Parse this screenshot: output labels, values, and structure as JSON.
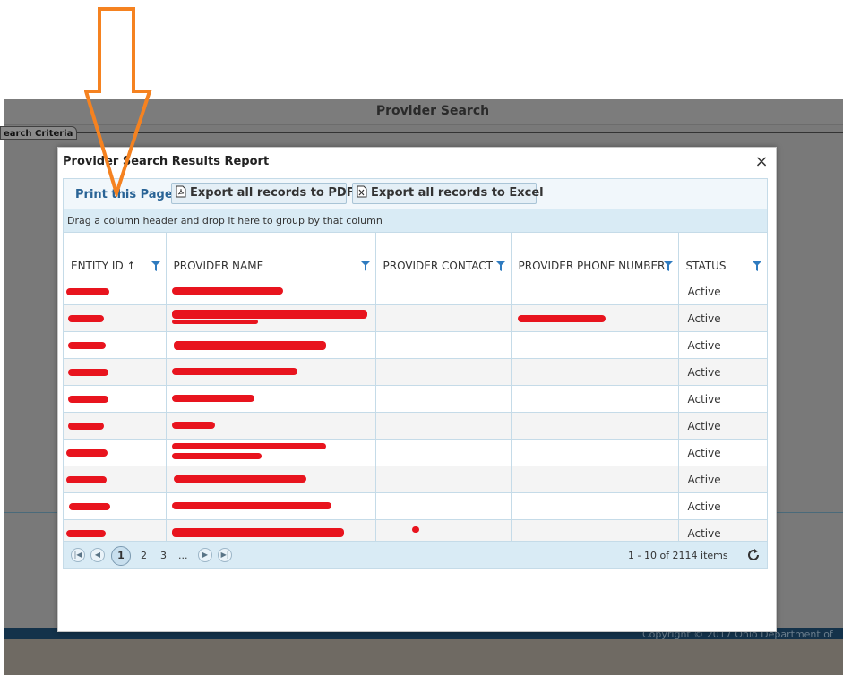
{
  "background": {
    "title": "Provider Search",
    "tab_label": "earch Criteria",
    "copyright": "Copyright © 2017 Ohio Department of"
  },
  "modal": {
    "title": "Provider Search Results Report",
    "close_glyph": "×",
    "print_link": "Print this Page",
    "export_pdf": "Export all records to PDF",
    "export_excel": "Export all records to Excel",
    "group_hint": "Drag a column header and drop it here to group by that column"
  },
  "grid": {
    "columns": [
      {
        "label": "ENTITY ID",
        "sort": "↑"
      },
      {
        "label": "PROVIDER NAME"
      },
      {
        "label": "PROVIDER CONTACT"
      },
      {
        "label": "PROVIDER PHONE NUMBER"
      },
      {
        "label": "STATUS"
      }
    ],
    "rows": [
      {
        "status": "Active"
      },
      {
        "status": "Active"
      },
      {
        "status": "Active"
      },
      {
        "status": "Active"
      },
      {
        "status": "Active"
      },
      {
        "status": "Active"
      },
      {
        "status": "Active"
      },
      {
        "status": "Active"
      },
      {
        "status": "Active"
      },
      {
        "status": "Active"
      }
    ]
  },
  "pager": {
    "pages": [
      "1",
      "2",
      "3",
      "..."
    ],
    "current_page": "1",
    "info": "1 - 10 of 2114 items"
  },
  "colors": {
    "accent": "#2a6496",
    "header_band": "#d9ebf5",
    "redaction": "#e8141e",
    "annotation_arrow": "#f58220"
  }
}
